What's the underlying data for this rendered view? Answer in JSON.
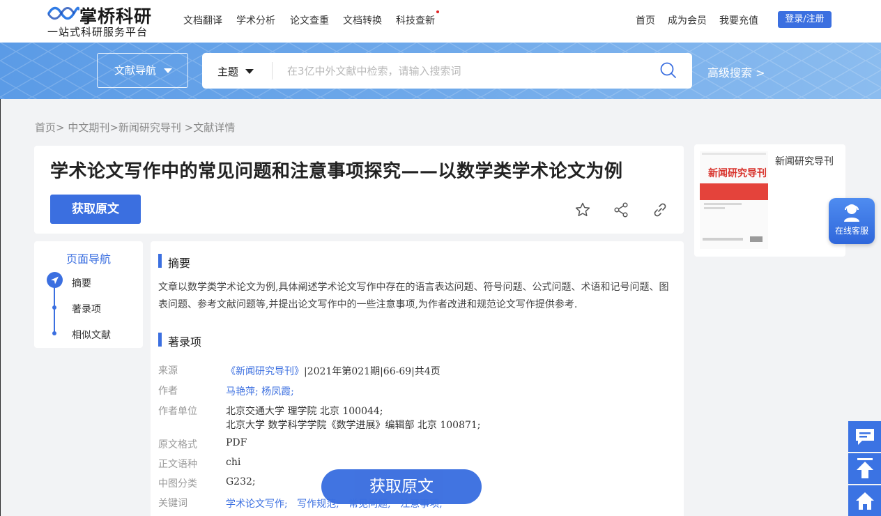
{
  "header": {
    "logo_name": "掌桥科研",
    "logo_slogan": "一站式科研服务平台",
    "nav": [
      "文档翻译",
      "学术分析",
      "论文查重",
      "文档转换",
      "科技查新"
    ],
    "right_links": [
      "首页",
      "成为会员",
      "我要充值"
    ],
    "login_label": "登录/注册"
  },
  "search": {
    "nav_select": "文献导航",
    "type": "主题",
    "placeholder": "在3亿中外文献中检索，请输入搜索词",
    "advanced": "高级搜索 >"
  },
  "breadcrumb": "首页> 中文期刊>新闻研究导刊 >文献详情",
  "article": {
    "title": "学术论文写作中的常见问题和注意事项探究——以数学类学术论文为例",
    "get_button": "获取原文"
  },
  "page_nav": {
    "title": "页面导航",
    "items": [
      "摘要",
      "著录项",
      "相似文献"
    ]
  },
  "abstract": {
    "heading": "摘要",
    "text": "文章以数学类学术论文为例,具体阐述学术论文写作中存在的语言表达问题、符号问题、公式问题、术语和记号问题、图表问题、参考文献问题等,并提出论文写作中的一些注意事项,为作者改进和规范论文写作提供参考."
  },
  "record": {
    "heading": "著录项",
    "source_label": "来源",
    "source_journal": "《新闻研究导刊》",
    "source_detail": "|2021年第021期|66-69|共4页",
    "authors_label": "作者",
    "authors": "马艳萍; 杨凤霞;",
    "affil_label": "作者单位",
    "affil_1": "北京交通大学 理学院 北京 100044;",
    "affil_2": "北京大学 数学科学学院《数学进展》编辑部 北京 100871;",
    "format_label": "原文格式",
    "format": "PDF",
    "lang_label": "正文语种",
    "lang": "chi",
    "class_label": "中图分类",
    "class": "G232;",
    "keywords_label": "关键词",
    "keywords": "学术论文写作;   写作规范;   常见问题;   注意事项;"
  },
  "float_button": "获取原文",
  "journal": {
    "name": "新闻研究导刊",
    "cover_title": "新闻研究导刊"
  },
  "customer_service": "在线客服",
  "colors": {
    "accent": "#3b6fe0",
    "band": "#6fa9ea"
  }
}
